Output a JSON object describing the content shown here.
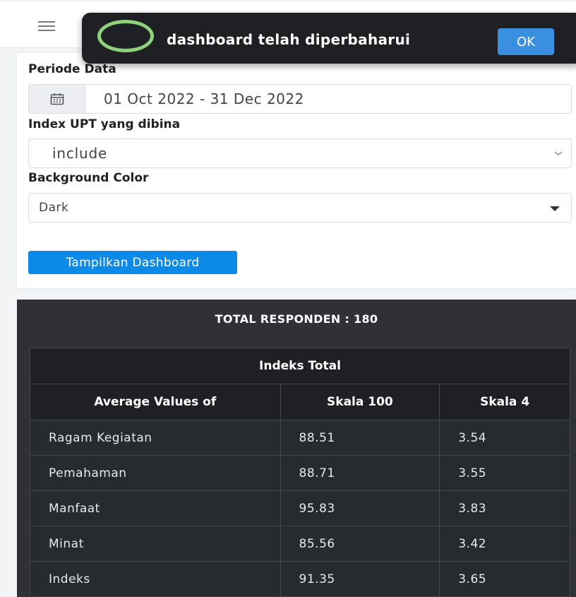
{
  "toast": {
    "message": "dashboard telah diperbaharui",
    "ok_label": "OK"
  },
  "form": {
    "period_label": "Periode Data",
    "period_value": "01 Oct 2022 - 31 Dec 2022",
    "index_label": "Index UPT yang dibina",
    "index_value": "include",
    "bg_label": "Background Color",
    "bg_value": "Dark",
    "submit_label": "Tampilkan Dashboard"
  },
  "dashboard": {
    "total_respondents": "TOTAL RESPONDEN : 180",
    "table_title": "Indeks Total",
    "columns": [
      "Average Values of",
      "Skala 100",
      "Skala 4"
    ],
    "rows": [
      [
        "Ragam Kegiatan",
        "88.51",
        "3.54"
      ],
      [
        "Pemahaman",
        "88.71",
        "3.55"
      ],
      [
        "Manfaat",
        "95.83",
        "3.83"
      ],
      [
        "Minat",
        "85.56",
        "3.42"
      ],
      [
        "Indeks",
        "91.35",
        "3.65"
      ]
    ]
  },
  "colors": {
    "primary": "#0d8ae8",
    "toast_bg": "#1f2023",
    "toast_ring": "#8fd27b",
    "dark_panel": "#2f3137"
  },
  "icons": {
    "menu": "hamburger-icon",
    "calendar": "calendar-icon",
    "dropdown": "chevron-down-icon",
    "select_caret": "caret-down-icon"
  }
}
